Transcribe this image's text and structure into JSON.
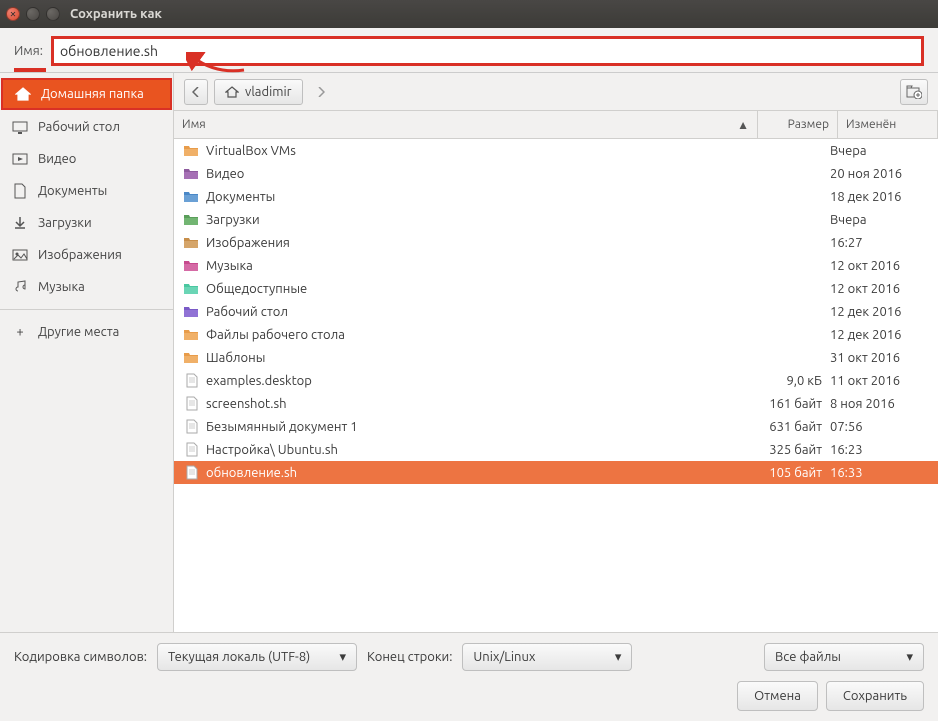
{
  "window": {
    "title": "Сохранить как"
  },
  "name": {
    "label": "Имя:",
    "value": "обновление.sh"
  },
  "sidebar": {
    "items": [
      {
        "label": "Домашняя папка",
        "icon": "home-icon",
        "active": true
      },
      {
        "label": "Рабочий стол",
        "icon": "desktop-icon"
      },
      {
        "label": "Видео",
        "icon": "video-icon"
      },
      {
        "label": "Документы",
        "icon": "document-icon"
      },
      {
        "label": "Загрузки",
        "icon": "download-icon"
      },
      {
        "label": "Изображения",
        "icon": "image-icon"
      },
      {
        "label": "Музыка",
        "icon": "music-icon"
      }
    ],
    "other": {
      "label": "Другие места"
    }
  },
  "pathbar": {
    "segment": "vladimir"
  },
  "columns": {
    "name": "Имя",
    "size": "Размер",
    "modified": "Изменён"
  },
  "files": [
    {
      "name": "VirtualBox VMs",
      "size": "",
      "modified": "Вчера",
      "type": "folder"
    },
    {
      "name": "Видео",
      "size": "",
      "modified": "20 ноя 2016",
      "type": "folder-video"
    },
    {
      "name": "Документы",
      "size": "",
      "modified": "18 дек 2016",
      "type": "folder-doc"
    },
    {
      "name": "Загрузки",
      "size": "",
      "modified": "Вчера",
      "type": "folder-dl"
    },
    {
      "name": "Изображения",
      "size": "",
      "modified": "16:27",
      "type": "folder-img"
    },
    {
      "name": "Музыка",
      "size": "",
      "modified": "12 окт 2016",
      "type": "folder-music"
    },
    {
      "name": "Общедоступные",
      "size": "",
      "modified": "12 окт 2016",
      "type": "folder-public"
    },
    {
      "name": "Рабочий стол",
      "size": "",
      "modified": "12 дек 2016",
      "type": "folder-desktop"
    },
    {
      "name": "Файлы рабочего стола",
      "size": "",
      "modified": "12 дек 2016",
      "type": "folder"
    },
    {
      "name": "Шаблоны",
      "size": "",
      "modified": "31 окт 2016",
      "type": "folder"
    },
    {
      "name": "examples.desktop",
      "size": "9,0 кБ",
      "modified": "11 окт 2016",
      "type": "file"
    },
    {
      "name": "screenshot.sh",
      "size": "161 байт",
      "modified": "8 ноя 2016",
      "type": "file"
    },
    {
      "name": "Безымянный документ 1",
      "size": "631 байт",
      "modified": "07:56",
      "type": "file"
    },
    {
      "name": "Настройка\\ Ubuntu.sh",
      "size": "325 байт",
      "modified": "16:23",
      "type": "file"
    },
    {
      "name": "обновление.sh",
      "size": "105 байт",
      "modified": "16:33",
      "type": "file",
      "selected": true
    }
  ],
  "bottom": {
    "encoding_label": "Кодировка символов:",
    "encoding_value": "Текущая локаль (UTF-8)",
    "eol_label": "Конец строки:",
    "eol_value": "Unix/Linux",
    "filter_value": "Все файлы",
    "cancel": "Отмена",
    "save": "Сохранить"
  }
}
